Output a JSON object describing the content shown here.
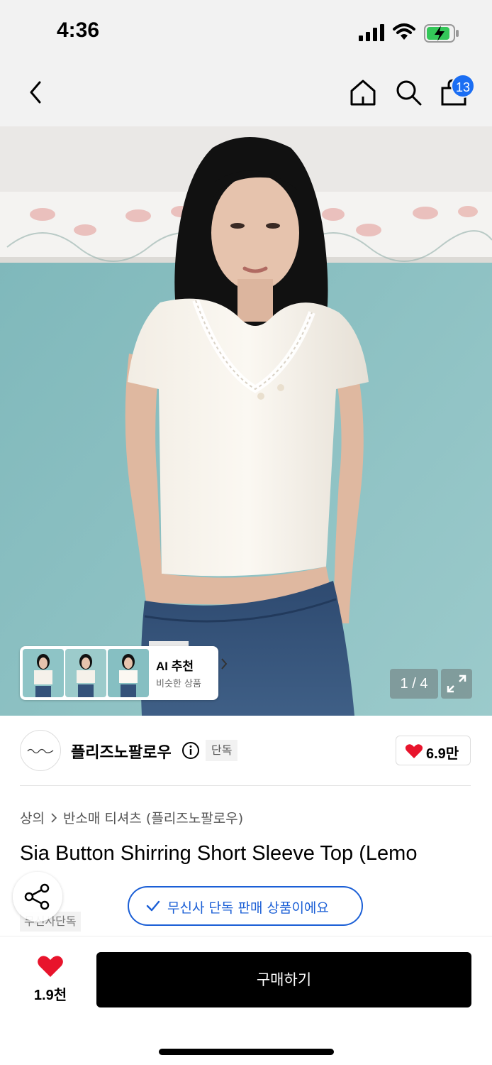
{
  "status_bar": {
    "time": "4:36"
  },
  "nav": {
    "cart_count": "13"
  },
  "gallery": {
    "ai_title": "AI 추천",
    "ai_subtitle": "비슷한 상품",
    "page_indicator": "1 / 4"
  },
  "brand": {
    "name": "플리즈노팔로우",
    "exclusive_badge": "단독",
    "likes": "6.9만"
  },
  "breadcrumb": {
    "category": "상의",
    "subcategory": "반소매 티셔츠 (플리즈노팔로우)"
  },
  "product": {
    "title": "Sia Button Shirring Short Sleeve Top (Lemo",
    "exclusive_tag": "무신사단독",
    "exclusive_notice": "무신사 단독 판매 상품이에요"
  },
  "bottom": {
    "wish_count": "1.9천",
    "buy_label": "구매하기"
  },
  "colors": {
    "accent_blue": "#1b5fd6",
    "badge_blue": "#1b6ef3",
    "heart_red": "#e8142c",
    "wall_teal": "#8ec4c6"
  }
}
